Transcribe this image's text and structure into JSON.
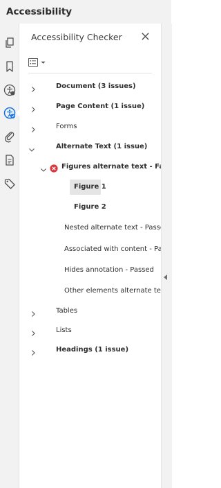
{
  "window": {
    "title": "Accessibility"
  },
  "rail": {
    "items": [
      {
        "icon": "pages-icon",
        "label": "Page Thumbnails"
      },
      {
        "icon": "bookmark-icon",
        "label": "Bookmarks"
      },
      {
        "icon": "accessibility-tags-icon",
        "label": "Accessibility Tags"
      },
      {
        "icon": "accessibility-checker-icon",
        "label": "Accessibility Checker",
        "active": true
      },
      {
        "icon": "attachment-icon",
        "label": "Attachments"
      },
      {
        "icon": "content-icon",
        "label": "Content"
      },
      {
        "icon": "tag-icon",
        "label": "Tags"
      }
    ]
  },
  "panel": {
    "title": "Accessibility Checker",
    "options_icon": "options-menu-icon",
    "close_icon": "close-icon",
    "accent": "#1473e6",
    "error_color": "#d7373f"
  },
  "tree": {
    "document": "Document (3 issues)",
    "page_content": "Page Content (1 issue)",
    "forms": "Forms",
    "alternate_text": "Alternate Text (1 issue)",
    "figures_alt": "Figures alternate text - Failed",
    "figure1": "Figure 1",
    "figure2": "Figure 2",
    "nested_alt": "Nested alternate text - Passed",
    "associated": "Associated with content - Pass",
    "hides_annotation": "Hides annotation - Passed",
    "other_elements": "Other elements alternate text -",
    "tables": "Tables",
    "lists": "Lists",
    "headings": "Headings (1 issue)"
  }
}
